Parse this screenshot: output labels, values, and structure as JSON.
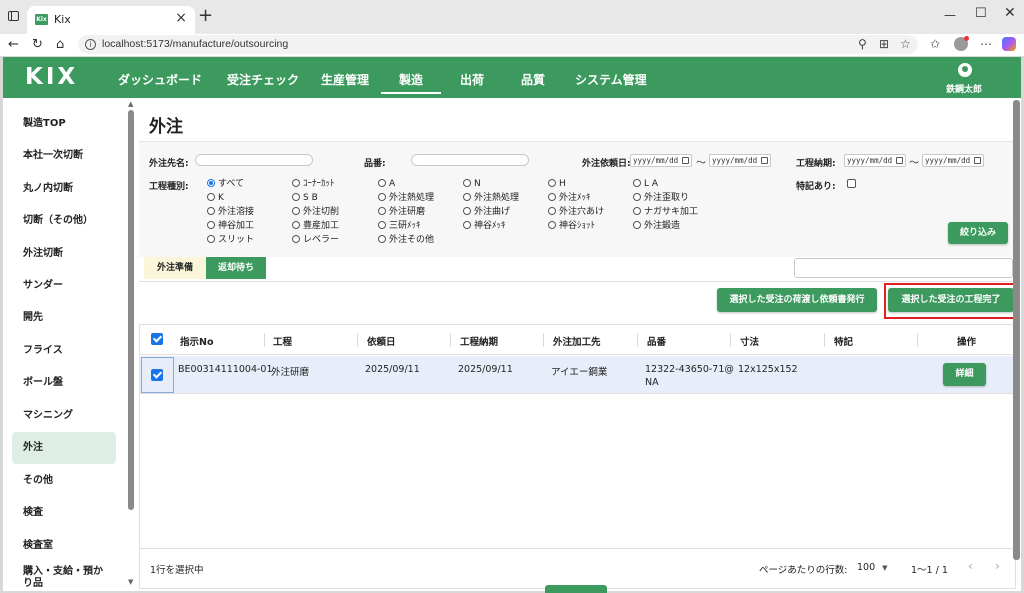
{
  "browser": {
    "tab_title": "Kix",
    "favicon_text": "Kix",
    "url": "localhost:5173/manufacture/outsourcing"
  },
  "header": {
    "logo": "KIX",
    "nav": [
      "ダッシュボード",
      "受注チェック",
      "生産管理",
      "製造",
      "出荷",
      "品質",
      "システム管理"
    ],
    "active_nav": "製造",
    "user_name": "鉄鋼太郎"
  },
  "sidebar": {
    "items": [
      "製造TOP",
      "本社一次切断",
      "丸ノ内切断",
      "切断（その他）",
      "外注切断",
      "サンダー",
      "開先",
      "フライス",
      "ボール盤",
      "マシニング",
      "外注",
      "その他",
      "検査",
      "検査室",
      "購入・支給・預かり品"
    ],
    "active": "外注"
  },
  "page": {
    "title": "外注"
  },
  "filters": {
    "vendor_label": "外注先名:",
    "vendor_value": "",
    "part_label": "品番:",
    "part_value": "",
    "request_date_label": "外注依頼日:",
    "request_from_placeholder": "yyyy/mm/dd",
    "request_to_placeholder": "yyyy/mm/dd",
    "deadline_label": "工程納期:",
    "deadline_from_placeholder": "yyyy/mm/dd",
    "deadline_to_placeholder": "yyyy/mm/dd",
    "tilde": "～",
    "process_type_label": "工程種別:",
    "process_options": [
      [
        "すべて",
        "K",
        "外注溶接",
        "神谷加工",
        "スリット"
      ],
      [
        "ｺｰﾅｰｶｯﾄ",
        "S B",
        "外注切削",
        "豊産加工",
        "レベラー"
      ],
      [
        "A",
        "外注熱処理",
        "外注研磨",
        "三研ﾒｯｷ",
        "外注その他"
      ],
      [
        "N",
        "外注熱処理",
        "外注曲げ",
        "神谷ﾒｯｷ"
      ],
      [
        "H",
        "外注ﾒｯｷ",
        "外注穴あけ",
        "神谷ｼｮｯﾄ"
      ],
      [
        "L A",
        "外注歪取り",
        "ナガサキ加工",
        "外注鍛造"
      ]
    ],
    "process_selected": "すべて",
    "special_label": "特記あり:",
    "special_checked": false,
    "filter_button": "絞り込み"
  },
  "tabs": {
    "items": [
      "外注準備",
      "返却待ち"
    ],
    "active": "返却待ち",
    "search_value": ""
  },
  "actions": {
    "issue_request": "選択した受注の荷渡し依頼書発行",
    "complete_process": "選択した受注の工程完了"
  },
  "table": {
    "columns": [
      "指示No",
      "工程",
      "依頼日",
      "工程納期",
      "外注加工先",
      "品番",
      "寸法",
      "特記",
      "操作"
    ],
    "rows": [
      {
        "selected": true,
        "instruction_no": "BE00314111004-01",
        "process": "外注研磨",
        "request_date": "2025/09/11",
        "deadline": "2025/09/11",
        "vendor": "アイエー鋼業",
        "part_line1": "12322-43650-71@",
        "part_line2": "NA",
        "dimensions": "12x125x152",
        "note": "",
        "action": "詳細"
      }
    ]
  },
  "footer": {
    "selection_text": "1行を選択中",
    "rows_per_page_label": "ページあたりの行数:",
    "rows_per_page": "100",
    "range": "1〜1 / 1"
  },
  "colors": {
    "brand_green": "#3c9a5f",
    "active_side_bg": "#deeee4",
    "selected_row": "#e7eefa",
    "checkbox_blue": "#1a73e8",
    "highlight_red": "#e02020"
  }
}
